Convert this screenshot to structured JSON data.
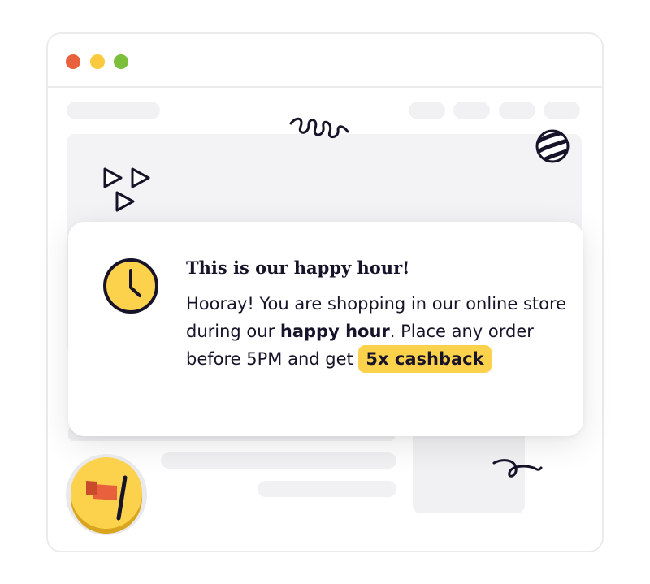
{
  "window": {
    "controls": [
      "close-dot",
      "minimize-dot",
      "maximize-dot"
    ],
    "colors": {
      "close": "#e8603c",
      "minimize": "#fbc93d",
      "maximize": "#7cbf3a"
    }
  },
  "notice": {
    "title": "This is our happy hour!",
    "line1": "Hooray! You are shopping in our online store during our ",
    "emphasis": "happy hour",
    "line2": ". Place any order before 5PM and get ",
    "highlight": "5x cashback",
    "icon": "clock-icon",
    "accent_color": "#fcd24c"
  },
  "badge": {
    "icon": "flag-icon"
  },
  "decorations": [
    "squiggle-icon",
    "striped-ball-icon",
    "play-triangles-icon",
    "swirl-icon"
  ]
}
